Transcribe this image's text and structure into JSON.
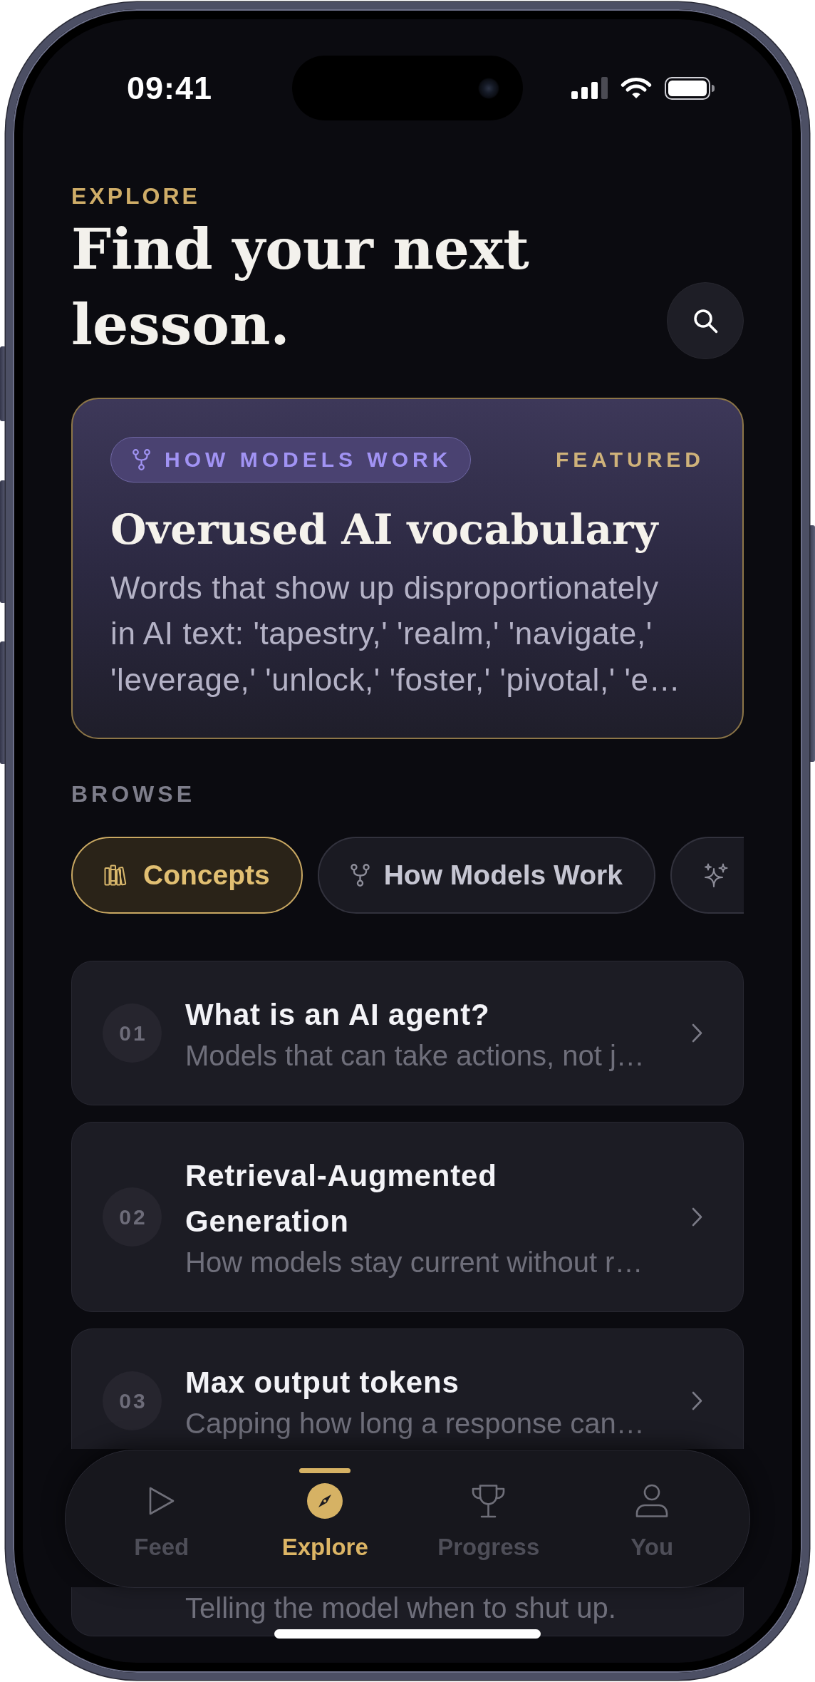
{
  "status_bar": {
    "time": "09:41"
  },
  "header": {
    "eyebrow": "EXPLORE",
    "title": "Find your next lesson."
  },
  "featured": {
    "category": "HOW MODELS WORK",
    "badge": "FEATURED",
    "title": "Overused AI vocabulary",
    "description": "Words that show up disproportionately in AI text: 'tapestry,' 'realm,' 'navigate,' 'leverage,' 'unlock,' 'foster,' 'pivotal,' 'e…"
  },
  "browse": {
    "heading": "BROWSE",
    "chips": [
      {
        "label": "Concepts",
        "selected": true
      },
      {
        "label": "How Models Work",
        "selected": false
      },
      {
        "selected": false
      }
    ]
  },
  "lessons": [
    {
      "number": "01",
      "title": "What is an AI agent?",
      "subtitle": "Models that can take actions, not j…"
    },
    {
      "number": "02",
      "title": "Retrieval-Augmented Generation",
      "subtitle": "How models stay current without r…"
    },
    {
      "number": "03",
      "title": "Max output tokens",
      "subtitle": "Capping how long a response can…"
    },
    {
      "subtitle": "Telling the model when to shut up."
    }
  ],
  "tab_bar": [
    {
      "label": "Feed",
      "selected": false
    },
    {
      "label": "Explore",
      "selected": true
    },
    {
      "label": "Progress",
      "selected": false
    },
    {
      "label": "You",
      "selected": false
    }
  ]
}
